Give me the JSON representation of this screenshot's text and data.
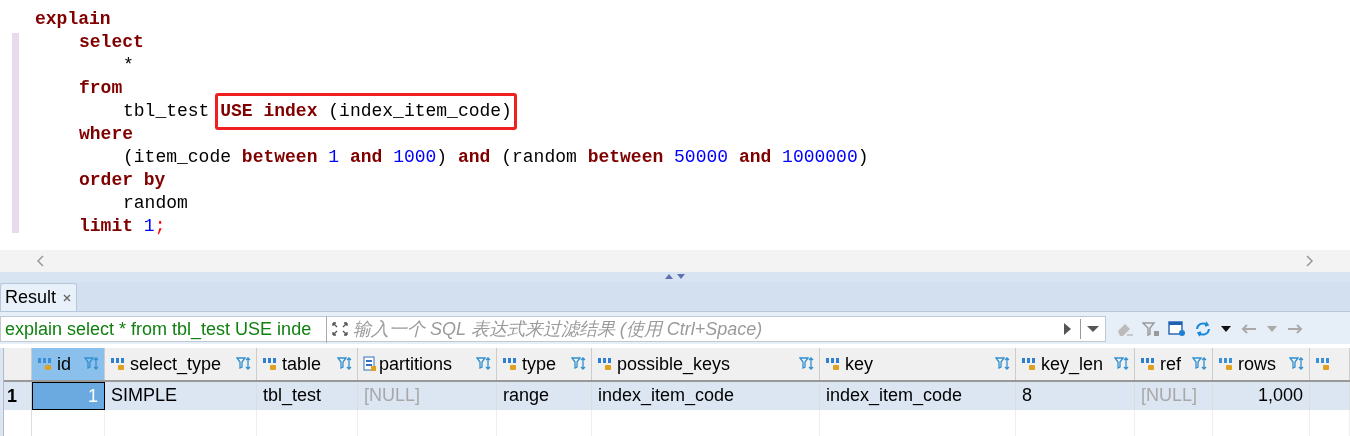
{
  "editor": {
    "lines": [
      {
        "segments": [
          {
            "boxed": false,
            "tokens": [
              {
                "kind": "keyword",
                "text": "explain"
              }
            ]
          }
        ],
        "children": [
          {
            "segments": [
              {
                "boxed": false,
                "tokens": [
                  {
                    "kind": "keyword",
                    "text": "select"
                  }
                ]
              }
            ],
            "children": [
              {
                "segments": [
                  {
                    "boxed": false,
                    "tokens": [
                      {
                        "kind": "plain",
                        "text": "*"
                      }
                    ]
                  }
                ]
              }
            ]
          },
          {
            "segments": [
              {
                "boxed": false,
                "tokens": [
                  {
                    "kind": "keyword",
                    "text": "from"
                  }
                ]
              }
            ],
            "children": [
              {
                "segments": [
                  {
                    "boxed": false,
                    "tokens": [
                      {
                        "kind": "plain",
                        "text": "tbl_test",
                        "gap": true
                      }
                    ]
                  },
                  {
                    "boxed": true,
                    "tokens": [
                      {
                        "kind": "keyword",
                        "text": "USE",
                        "gap": true
                      },
                      {
                        "kind": "keyword",
                        "text": "index",
                        "gap": true
                      },
                      {
                        "kind": "plain",
                        "text": "(index_item_code)"
                      }
                    ]
                  }
                ]
              }
            ]
          },
          {
            "segments": [
              {
                "boxed": false,
                "tokens": [
                  {
                    "kind": "keyword",
                    "text": "where"
                  }
                ]
              }
            ],
            "children": [
              {
                "segments": [
                  {
                    "boxed": false,
                    "tokens": [
                      {
                        "kind": "plain",
                        "text": "(item_code",
                        "gap": true
                      },
                      {
                        "kind": "keyword",
                        "text": "between",
                        "gap": true
                      },
                      {
                        "kind": "number",
                        "text": "1",
                        "gap": true
                      },
                      {
                        "kind": "keyword",
                        "text": "and",
                        "gap": true
                      },
                      {
                        "kind": "number",
                        "text": "1000"
                      },
                      {
                        "kind": "plain",
                        "text": ")",
                        "gap": true
                      },
                      {
                        "kind": "keyword",
                        "text": "and",
                        "gap": true
                      },
                      {
                        "kind": "plain",
                        "text": "(random",
                        "gap": true
                      },
                      {
                        "kind": "keyword",
                        "text": "between",
                        "gap": true
                      },
                      {
                        "kind": "number",
                        "text": "50000",
                        "gap": true
                      },
                      {
                        "kind": "keyword",
                        "text": "and",
                        "gap": true
                      },
                      {
                        "kind": "number",
                        "text": "1000000"
                      },
                      {
                        "kind": "plain",
                        "text": ")"
                      }
                    ]
                  }
                ]
              }
            ]
          },
          {
            "segments": [
              {
                "boxed": false,
                "tokens": [
                  {
                    "kind": "keyword",
                    "text": "order by"
                  }
                ]
              }
            ],
            "children": [
              {
                "segments": [
                  {
                    "boxed": false,
                    "tokens": [
                      {
                        "kind": "plain",
                        "text": "random"
                      }
                    ]
                  }
                ]
              }
            ]
          },
          {
            "segments": [
              {
                "boxed": false,
                "tokens": [
                  {
                    "kind": "keyword",
                    "text": "limit",
                    "gap": true
                  },
                  {
                    "kind": "number",
                    "text": "1"
                  },
                  {
                    "kind": "punct",
                    "text": ";"
                  }
                ]
              }
            ]
          }
        ]
      }
    ]
  },
  "results": {
    "tabs": [
      {
        "label": "Result",
        "selected": true
      }
    ],
    "query": "explain select * from tbl_test USE inde",
    "filter": {
      "placeholder": "输入一个 SQL 表达式来过滤结果 (使用 Ctrl+Space)"
    },
    "columns": [
      {
        "name": "id",
        "kind": "number"
      },
      {
        "name": "select_type",
        "kind": "text"
      },
      {
        "name": "table",
        "kind": "text"
      },
      {
        "name": "partitions",
        "kind": "partition"
      },
      {
        "name": "type",
        "kind": "text"
      },
      {
        "name": "possible_keys",
        "kind": "text"
      },
      {
        "name": "key",
        "kind": "text"
      },
      {
        "name": "key_len",
        "kind": "text"
      },
      {
        "name": "ref",
        "kind": "text"
      },
      {
        "name": "rows",
        "kind": "number"
      },
      {
        "kind": "number"
      }
    ],
    "rows": [
      {
        "number": "1",
        "selected": true,
        "cells": [
          {
            "text": "1",
            "null": false,
            "focused": true
          },
          {
            "text": "SIMPLE",
            "null": false,
            "focused": false
          },
          {
            "text": "tbl_test",
            "null": false,
            "focused": false
          },
          {
            "text": "[NULL]",
            "null": true,
            "focused": false
          },
          {
            "text": "range",
            "null": false,
            "focused": false
          },
          {
            "text": "index_item_code",
            "null": false,
            "focused": false
          },
          {
            "text": "index_item_code",
            "null": false,
            "focused": false
          },
          {
            "text": "8",
            "null": false,
            "focused": false
          },
          {
            "text": "[NULL]",
            "null": true,
            "focused": false
          },
          {
            "text": "1,000",
            "null": false,
            "focused": false
          },
          {
            "focused": false
          }
        ]
      }
    ]
  }
}
